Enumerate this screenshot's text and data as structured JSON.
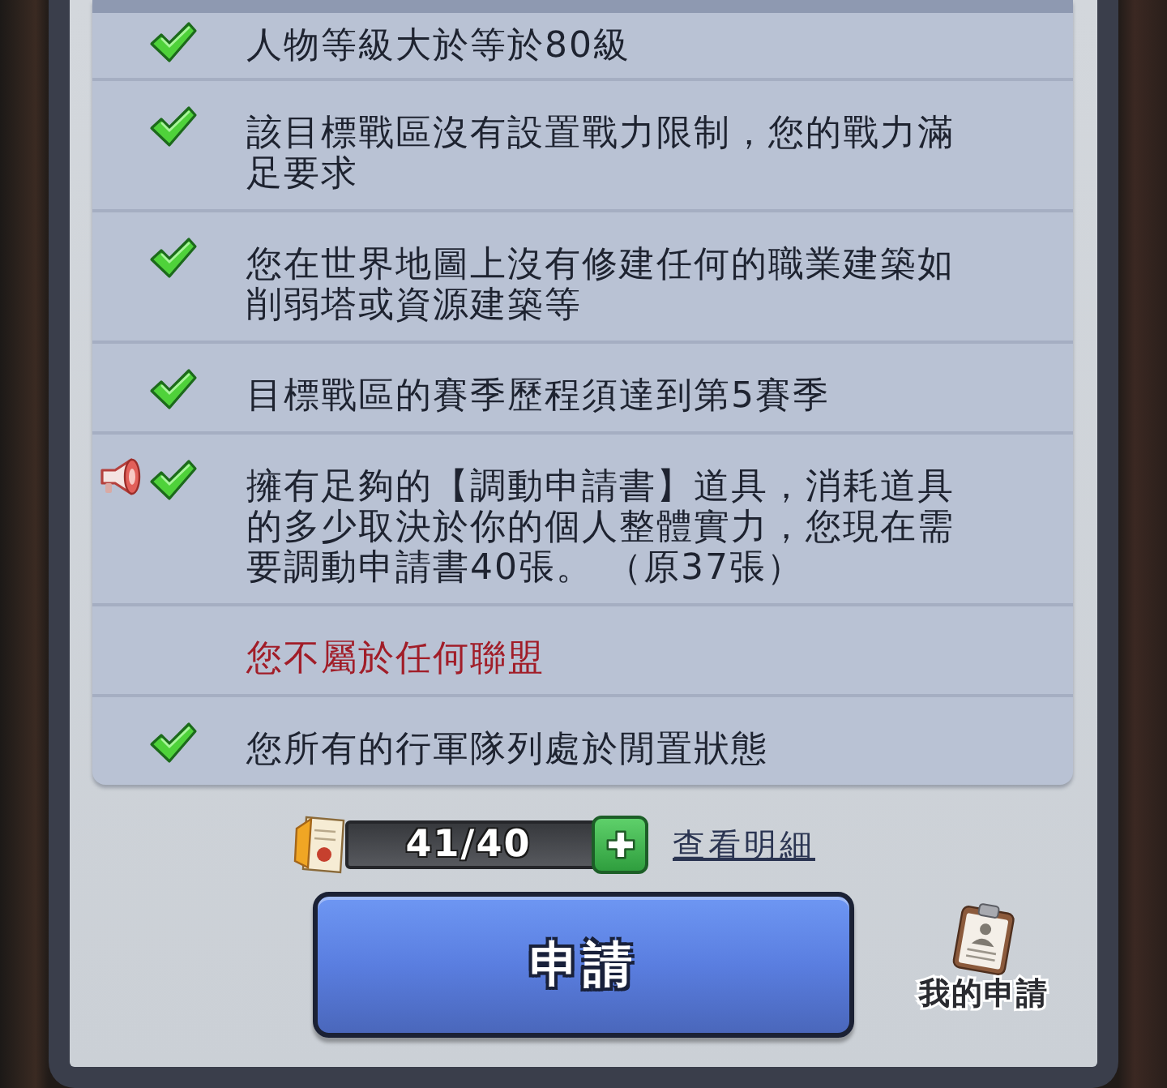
{
  "requirements": [
    {
      "text": "人物等級大於等於80級",
      "met": true,
      "notice": false
    },
    {
      "text": "該目標戰區沒有設置戰力限制，您的戰力滿足要求",
      "met": true,
      "notice": false
    },
    {
      "text": "您在世界地圖上沒有修建任何的職業建築如削弱塔或資源建築等",
      "met": true,
      "notice": false
    },
    {
      "text": "目標戰區的賽季歷程須達到第5賽季",
      "met": true,
      "notice": false
    },
    {
      "text": "擁有足夠的【調動申請書】道具，消耗道具的多少取決於你的個人整體實力，您現在需要調動申請書40張。 （原37張）",
      "met": true,
      "notice": true
    },
    {
      "text": "您不屬於任何聯盟",
      "met": false,
      "notice": false
    },
    {
      "text": "您所有的行軍隊列處於閒置狀態",
      "met": true,
      "notice": false
    }
  ],
  "cost": {
    "amount": "41/40"
  },
  "details_link": "查看明細",
  "apply_button": "申請",
  "my_applications": "我的申請"
}
